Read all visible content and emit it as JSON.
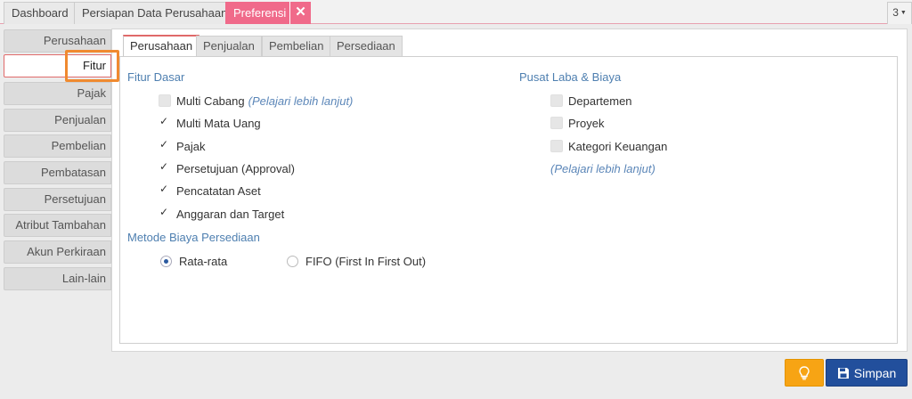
{
  "top_tabs": [
    {
      "label": "Dashboard"
    },
    {
      "label": "Persiapan Data Perusahaan"
    },
    {
      "label": "Preferensi"
    }
  ],
  "top_tab_count": "3",
  "sidebar": {
    "items": [
      {
        "label": "Perusahaan"
      },
      {
        "label": "Fitur"
      },
      {
        "label": "Pajak"
      },
      {
        "label": "Penjualan"
      },
      {
        "label": "Pembelian"
      },
      {
        "label": "Pembatasan"
      },
      {
        "label": "Persetujuan"
      },
      {
        "label": "Atribut Tambahan"
      },
      {
        "label": "Akun Perkiraan"
      },
      {
        "label": "Lain-lain"
      }
    ],
    "active": "Fitur"
  },
  "inner_tabs": [
    {
      "label": "Perusahaan"
    },
    {
      "label": "Penjualan"
    },
    {
      "label": "Pembelian"
    },
    {
      "label": "Persediaan"
    }
  ],
  "fitur_dasar": {
    "title": "Fitur Dasar",
    "items": [
      {
        "label": "Multi Cabang",
        "hint": "(Pelajari lebih lanjut)",
        "checked": false
      },
      {
        "label": "Multi Mata Uang",
        "checked": true
      },
      {
        "label": "Pajak",
        "checked": true
      },
      {
        "label": "Persetujuan (Approval)",
        "checked": true
      },
      {
        "label": "Pencatatan Aset",
        "checked": true
      },
      {
        "label": "Anggaran dan Target",
        "checked": true
      }
    ]
  },
  "pusat_laba": {
    "title": "Pusat Laba & Biaya",
    "items": [
      {
        "label": "Departemen",
        "checked": false
      },
      {
        "label": "Proyek",
        "checked": false
      },
      {
        "label": "Kategori Keuangan",
        "checked": false
      }
    ],
    "hint": "(Pelajari lebih lanjut)"
  },
  "metode_biaya": {
    "title": "Metode Biaya Persediaan",
    "options": [
      {
        "label": "Rata-rata",
        "selected": true
      },
      {
        "label": "FIFO (First In First Out)",
        "selected": false
      }
    ]
  },
  "buttons": {
    "save_label": "Simpan"
  },
  "colors": {
    "accent_pink": "#f06a8a",
    "section_blue": "#4e7fb0",
    "save_blue": "#224f9c",
    "tip_orange": "#f7a414",
    "highlight_orange": "#f08a30"
  },
  "icons": {
    "close": "close-icon",
    "tip": "lightbulb-icon",
    "save": "floppy-disk-icon",
    "count_caret": "chevron-down-icon"
  }
}
